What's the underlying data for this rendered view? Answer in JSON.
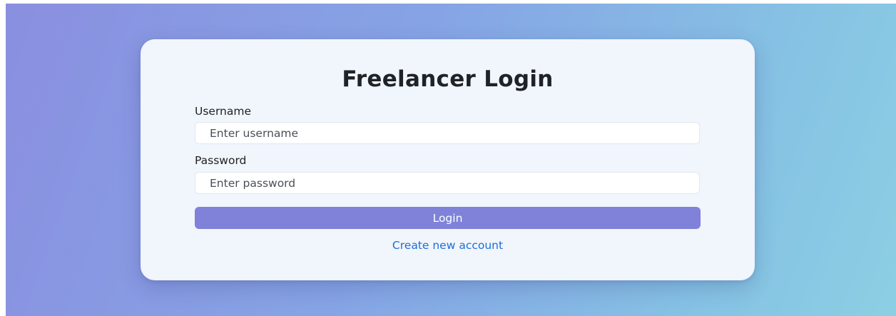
{
  "login_form": {
    "title": "Freelancer Login",
    "username": {
      "label": "Username",
      "placeholder": "Enter username",
      "value": ""
    },
    "password": {
      "label": "Password",
      "placeholder": "Enter password",
      "value": ""
    },
    "submit_label": "Login",
    "create_account_link": "Create new account"
  },
  "colors": {
    "background_gradient": [
      "#8a8fe0",
      "#86a5e5",
      "#86c2e4",
      "#8ccfe3"
    ],
    "card_background": "#f1f5fc",
    "button_background": "#7f82d8",
    "link_color": "#1d6fd8"
  }
}
